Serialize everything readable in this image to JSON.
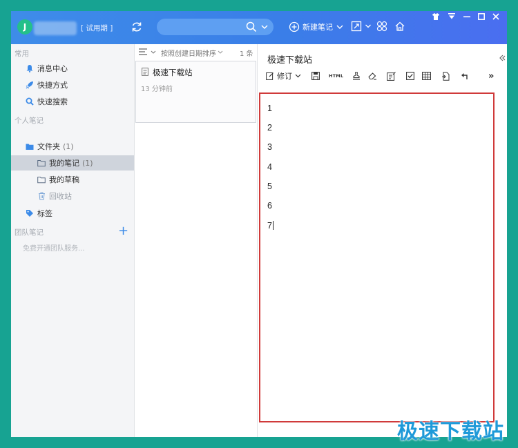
{
  "titlebar": {
    "avatar_letter": "J",
    "trial_label": "[ 试用期 ]",
    "new_note_label": "新建笔记",
    "search_placeholder": ""
  },
  "sidebar": {
    "section_common": "常用",
    "msg_center": "消息中心",
    "shortcuts": "快捷方式",
    "quick_search": "快速搜索",
    "section_personal": "个人笔记",
    "folder": "文件夹",
    "folder_count": "(1)",
    "my_notes": "我的笔记",
    "my_notes_count": "(1)",
    "my_drafts": "我的草稿",
    "recycle": "回收站",
    "tags": "标签",
    "section_team": "团队笔记",
    "team_hint": "免费开通团队服务..."
  },
  "note_list": {
    "sort_label": "按照创建日期排序",
    "count_label": "1 条",
    "notes": [
      {
        "title": "极速下载站",
        "time": "13 分钟前"
      }
    ]
  },
  "editor": {
    "title": "极速下载站",
    "revise_label": "修订",
    "html_label": "HTML",
    "lines": [
      "1",
      "2",
      "3",
      "4",
      "5",
      "6",
      "7"
    ]
  },
  "watermark": "极速下载站",
  "colors": {
    "titlebar": "#3e8ce9",
    "accent": "#3c8be8",
    "edit_border": "#d03a3a",
    "backdrop": "#17a392"
  }
}
